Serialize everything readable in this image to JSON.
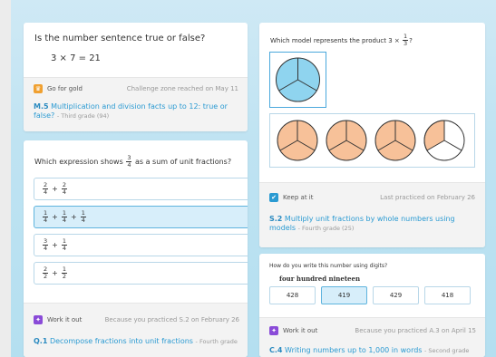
{
  "card1": {
    "question": "Is the number sentence true or false?",
    "equation": "3 × 7 = 21",
    "badge": "Go for gold",
    "meta": "Challenge zone reached on May 11",
    "skill_code": "M.5",
    "skill_name": "Multiplication and division facts up to 12: true or false?",
    "skill_grade": "- Third grade (94)"
  },
  "card2": {
    "question_pre": "Which expression shows",
    "question_frac": {
      "num": "3",
      "den": "4"
    },
    "question_post": "as a sum of unit fractions?",
    "options": [
      {
        "terms": [
          {
            "num": "2",
            "den": "4"
          },
          {
            "num": "2",
            "den": "4"
          }
        ]
      },
      {
        "terms": [
          {
            "num": "1",
            "den": "4"
          },
          {
            "num": "1",
            "den": "4"
          },
          {
            "num": "1",
            "den": "4"
          }
        ],
        "selected": true
      },
      {
        "terms": [
          {
            "num": "3",
            "den": "4"
          },
          {
            "num": "1",
            "den": "4"
          }
        ]
      },
      {
        "terms": [
          {
            "num": "2",
            "den": "2"
          },
          {
            "num": "1",
            "den": "2"
          }
        ]
      }
    ],
    "badge": "Work it out",
    "meta": "Because you practiced S.2 on February 26",
    "skill_code": "Q.1",
    "skill_name": "Decompose fractions into unit fractions",
    "skill_grade": "- Fourth grade"
  },
  "card3": {
    "question_pre": "Which model represents the product 3 ×",
    "question_frac": {
      "num": "1",
      "den": "3"
    },
    "question_post": "?",
    "badge": "Keep at it",
    "meta": "Last practiced on February 26",
    "skill_code": "S.2",
    "skill_name": "Multiply unit fractions by whole numbers using models",
    "skill_grade": "- Fourth grade (25)"
  },
  "card4": {
    "question": "How do you write this number using digits?",
    "number_words": "four hundred nineteen",
    "options": [
      "428",
      "419",
      "429",
      "418"
    ],
    "selected_index": 1,
    "badge": "Work it out",
    "meta": "Because you practiced A.3 on April 15",
    "skill_code": "C.4",
    "skill_name": "Writing numbers up to 1,000 in words",
    "skill_grade": "- Second grade"
  },
  "colors": {
    "accent_blue": "#2a9ad2",
    "gold": "#f0a030",
    "purple": "#8a4bd8",
    "blue_check": "#2a9ad2",
    "pie_blue": "#8fd4ef",
    "pie_orange": "#f7c199"
  },
  "icons": {
    "go_for_gold": "medal-icon",
    "work_it_out": "puzzle-icon",
    "keep_at_it": "check-icon"
  }
}
